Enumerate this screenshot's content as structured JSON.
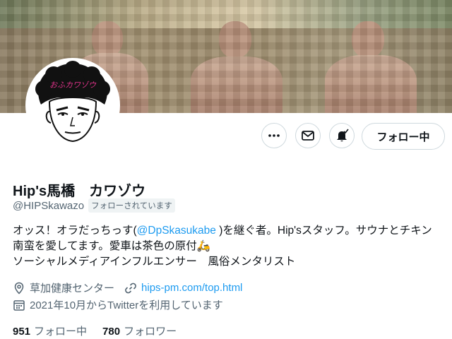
{
  "profile": {
    "name": "Hip's馬橋　カワゾウ",
    "handle": "@HIPSkawazo",
    "follows_you_badge": "フォローされています",
    "follow_button_label": "フォロー中",
    "bio": {
      "part1": "オッス！オラだっちっす(",
      "mention": "@DpSkasukabe",
      "part2": " )を継ぐ者。Hip'sスタッフ。サウナとチキン南蛮を愛してます。愛車は茶色の原付",
      "scooter_emoji": "🛵",
      "line2": "ソーシャルメディアインフルエンサー　風俗メンタリスト"
    },
    "location": "草加健康センター",
    "website": "hips-pm.com/top.html",
    "joined": "2021年10月からTwitterを利用しています",
    "following_count": "951",
    "following_label": "フォロー中",
    "followers_count": "780",
    "followers_label": "フォロワー",
    "avatar_text": "おふカワゾウ"
  },
  "icons": {
    "more": "more-icon",
    "message": "message-icon",
    "notifications": "bell-icon",
    "location": "location-pin-icon",
    "link": "link-icon",
    "calendar": "calendar-icon"
  },
  "colors": {
    "accent": "#1d9bf0",
    "secondary_text": "#536471",
    "border": "#cfd9de"
  }
}
